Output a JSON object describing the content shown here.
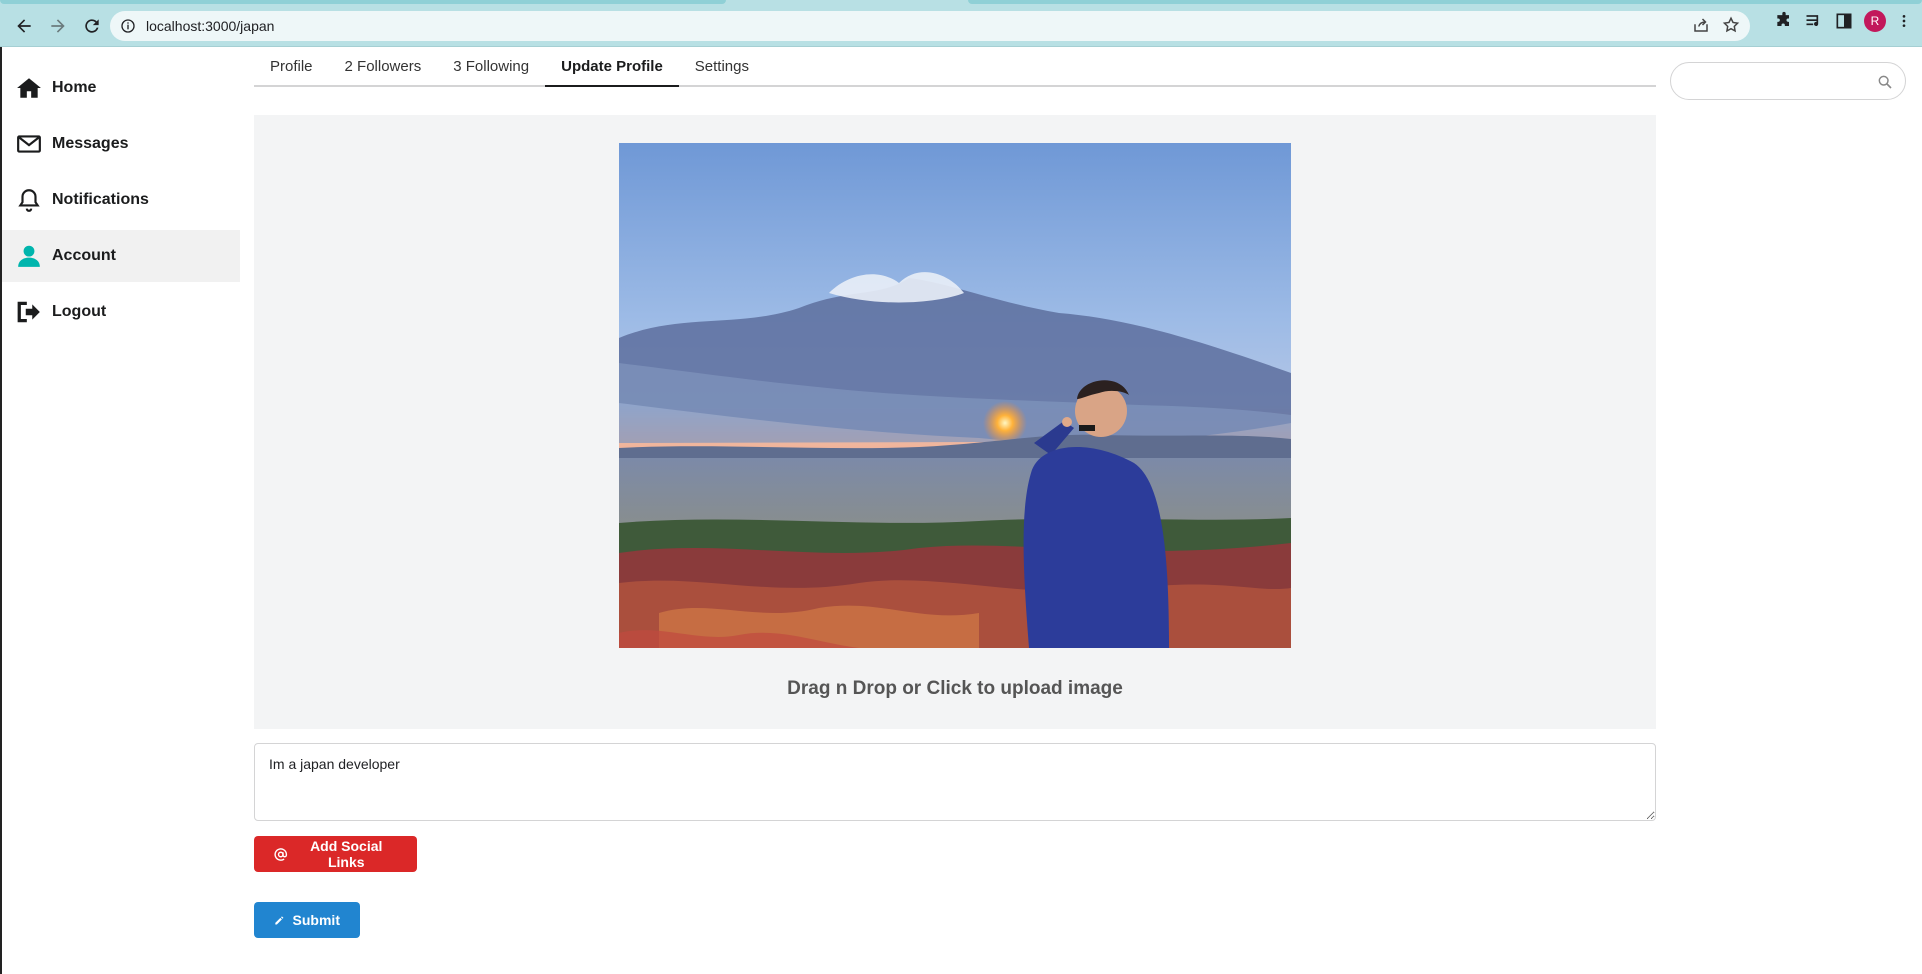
{
  "browser": {
    "url": "localhost:3000/japan",
    "profile_initial": "R"
  },
  "sidebar": {
    "items": [
      {
        "label": "Home"
      },
      {
        "label": "Messages"
      },
      {
        "label": "Notifications"
      },
      {
        "label": "Account",
        "active": true
      },
      {
        "label": "Logout"
      }
    ]
  },
  "tabs": [
    {
      "label": "Profile"
    },
    {
      "label": "2 Followers"
    },
    {
      "label": "3 Following"
    },
    {
      "label": "Update Profile",
      "active": true
    },
    {
      "label": "Settings"
    }
  ],
  "search": {
    "placeholder": "",
    "value": ""
  },
  "upload": {
    "hint": "Drag n Drop or Click to upload image"
  },
  "bio": {
    "value": "Im a japan developer"
  },
  "buttons": {
    "social_label": "Add Social Links",
    "submit_label": "Submit"
  },
  "colors": {
    "accent_active": "#00b5ad",
    "social_button": "#db2828",
    "submit_button": "#2185d0",
    "chrome": "#b8e0e4"
  }
}
